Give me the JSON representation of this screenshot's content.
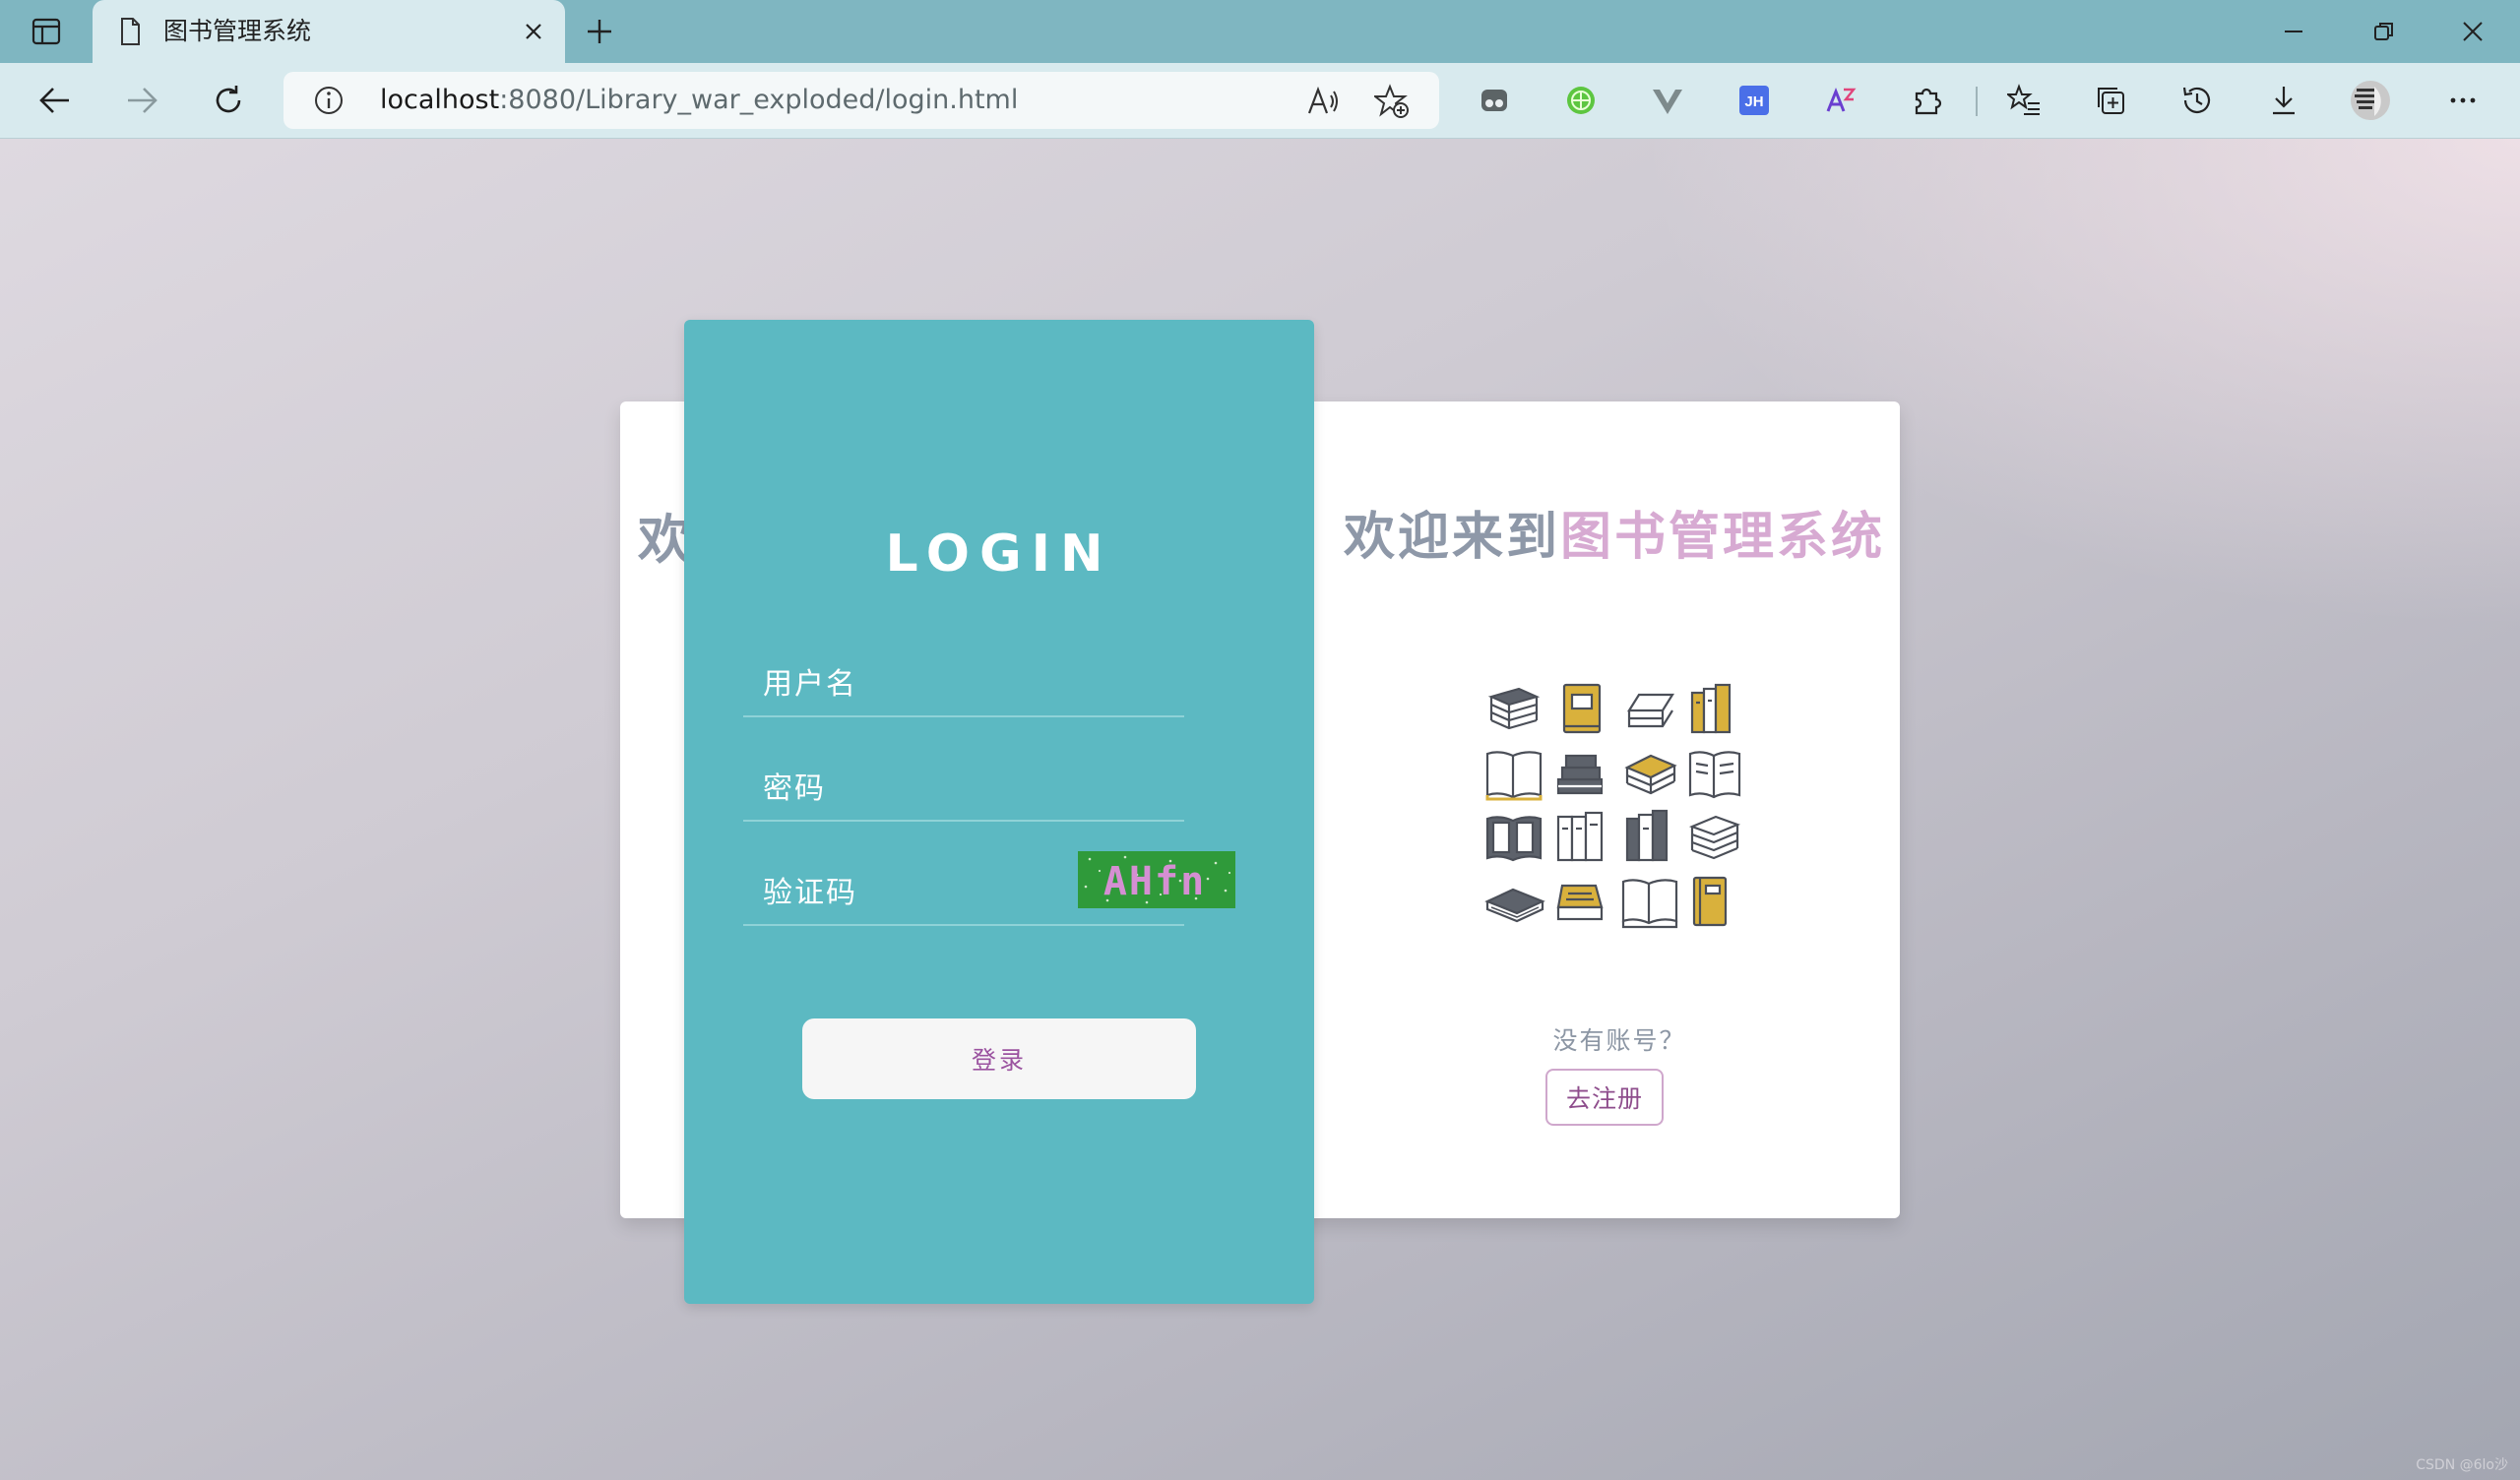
{
  "browser": {
    "tab_title": "图书管理系统",
    "address": {
      "host": "localhost",
      "rest": ":8080/Library_war_exploded/login.html"
    },
    "extensions": {
      "jh_label": "JH"
    }
  },
  "page": {
    "back_card_partial_title": "欢",
    "welcome_part1": "欢迎来到",
    "welcome_part2": "图书管理系统",
    "no_account_text": "没有账号？",
    "register_label": "去注册",
    "watermark": "CSDN @6lo沙"
  },
  "login": {
    "title": "LOGIN",
    "username_placeholder": "用户名",
    "password_placeholder": "密码",
    "captcha_placeholder": "验证码",
    "captcha_text": "AHfn",
    "submit_label": "登录"
  },
  "colors": {
    "panel": "#5cb9c2",
    "welcome_gray": "#8e98a8",
    "welcome_pink": "#d7aad2",
    "register_text": "#8e4d8c",
    "captcha_bg": "#2f9a3a",
    "captcha_text": "#d58fd3"
  }
}
